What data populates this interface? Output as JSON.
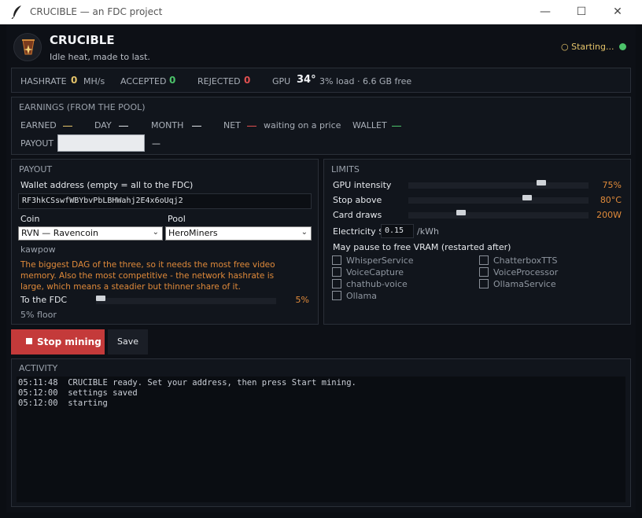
{
  "window": {
    "title": "CRUCIBLE — an FDC project",
    "minimize": "—",
    "maximize": "☐",
    "close": "✕"
  },
  "header": {
    "app_name": "CRUCIBLE",
    "tagline": "Idle heat, made to last.",
    "status": "○ Starting...",
    "status_color": "#4cc36a"
  },
  "stats": {
    "hashrate_label": "HASHRATE",
    "hashrate_value": "0",
    "hashrate_unit": "MH/s",
    "accepted_label": "ACCEPTED",
    "accepted_value": "0",
    "rejected_label": "REJECTED",
    "rejected_value": "0",
    "gpu_label": "GPU",
    "gpu_temp": "34°",
    "gpu_detail": "3% load · 6.6 GB free"
  },
  "earnings": {
    "title": "EARNINGS (FROM THE POOL)",
    "earned_label": "EARNED",
    "day_label": "DAY",
    "month_label": "MONTH",
    "net_label": "NET",
    "net_text": "waiting on a price",
    "wallet_label": "WALLET",
    "payout_label": "PAYOUT",
    "payout_value": "",
    "payout_suffix": "—"
  },
  "payout": {
    "title": "PAYOUT",
    "wallet_label": "Wallet address  (empty = all to the FDC)",
    "wallet_value": "RF3hkCSswfWBYbvPbLBHWahj2E4x6oUqj2",
    "coin_label": "Coin",
    "coin_value": "RVN — Ravencoin",
    "pool_label": "Pool",
    "pool_value": "HeroMiners",
    "algo": "kawpow",
    "description": "The biggest DAG of the three, so it needs the most free video memory. Also the most competitive - the network hashrate is large, which means a steadier but thinner share of it.",
    "fdc_label": "To the FDC",
    "fdc_value": "5%",
    "fdc_fraction": 0.0,
    "floor": "5% floor"
  },
  "limits": {
    "title": "LIMITS",
    "gpu_intensity_label": "GPU intensity",
    "gpu_intensity_value": "75%",
    "gpu_intensity_fraction": 0.75,
    "stop_above_label": "Stop above",
    "stop_above_value": "80°C",
    "stop_above_fraction": 0.67,
    "card_draws_label": "Card draws",
    "card_draws_value": "200W",
    "card_draws_fraction": 0.28,
    "electricity_label": "Electricity $",
    "electricity_value": "0.15",
    "electricity_unit": "/kWh",
    "pause_label": "May pause to free VRAM (restarted after)",
    "services": [
      "WhisperService",
      "ChatterboxTTS",
      "VoiceCapture",
      "VoiceProcessor",
      "chathub-voice",
      "OllamaService",
      "Ollama"
    ]
  },
  "actions": {
    "stop_label": "Stop mining",
    "save_label": "Save"
  },
  "activity": {
    "title": "ACTIVITY",
    "lines": [
      {
        "time": "05:11:48",
        "text": "CRUCIBLE ready. Set your address, then press Start mining."
      },
      {
        "time": "05:12:00",
        "text": "settings saved"
      },
      {
        "time": "05:12:00",
        "text": "starting"
      }
    ]
  },
  "colors": {
    "accent_yellow": "#e5c46a",
    "accent_green": "#4cc36a",
    "accent_red": "#e05050",
    "accent_orange": "#e08a3a",
    "stop_button": "#c43a3a"
  }
}
